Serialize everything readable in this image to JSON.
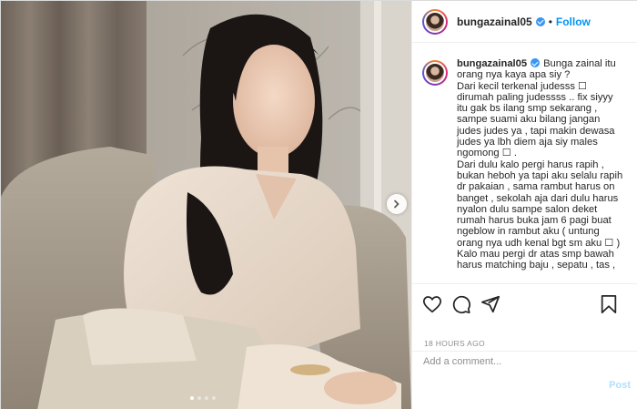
{
  "colors": {
    "accent": "#0095f6",
    "verified": "#3897f0",
    "post_disabled": "#b2dffc",
    "muted": "#8e8e8e"
  },
  "header": {
    "username": "bungazainal05",
    "separator": "•",
    "follow_label": "Follow"
  },
  "caption": {
    "username": "bungazainal05",
    "lines": [
      "Bunga zainal itu orang nya kaya apa siy ?",
      "Dari kecil terkenal judesss ☐ dirumah paling judessss .. fix siyyy itu gak bs ilang smp sekarang , sampe suami aku bilang jangan judes judes ya , tapi makin dewasa judes ya lbh diem aja siy males ngomong ☐ .",
      "Dari dulu kalo pergi harus rapih , bukan heboh ya tapi aku selalu rapih dr pakaian , sama rambut harus on banget , sekolah aja dari dulu harus nyalon dulu sampe salon deket rumah harus buka jam 6 pagi buat ngeblow in rambut aku ( untung orang nya udh kenal bgt sm aku ☐ )",
      "Kalo mau pergi dr atas smp bawah harus matching baju , sepatu , tas ,"
    ]
  },
  "actions": {
    "icons": [
      "heart-icon",
      "comment-icon",
      "share-icon",
      "bookmark-icon"
    ]
  },
  "timestamp": "18 HOURS AGO",
  "comment_box": {
    "placeholder": "Add a comment...",
    "post_label": "Post"
  },
  "carousel": {
    "slides": 4,
    "active_index": 0
  }
}
